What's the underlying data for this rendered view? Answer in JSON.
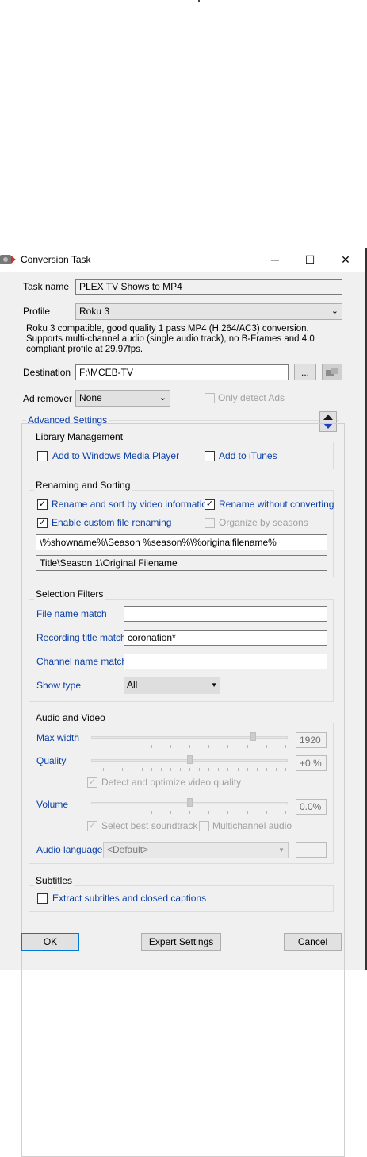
{
  "window": {
    "title": "Conversion Task",
    "minimize_glyph": "─",
    "maximize_glyph": "☐",
    "close_glyph": "✕"
  },
  "task": {
    "label": "Task name",
    "value": "PLEX TV Shows to MP4"
  },
  "profile": {
    "label": "Profile",
    "selected": "Roku 3",
    "description": "Roku 3 compatible, good quality 1 pass MP4 (H.264/AC3) conversion. Supports multi-channel audio (single audio track), no B-Frames and 4.0 compliant profile at 29.97fps."
  },
  "destination": {
    "label": "Destination",
    "value": "F:\\MCEB-TV",
    "browse_label": "..."
  },
  "ad_remover": {
    "label": "Ad remover",
    "selected": "None",
    "only_detect_label": "Only detect Ads"
  },
  "advanced": {
    "label": "Advanced Settings"
  },
  "library": {
    "title": "Library Management",
    "wmp_label": "Add to Windows Media Player",
    "itunes_label": "Add to iTunes"
  },
  "renaming": {
    "title": "Renaming and Sorting",
    "rename_sort_label": "Rename and sort by video information",
    "rename_without_label": "Rename without converting",
    "custom_label": "Enable custom file renaming",
    "seasons_label": "Organize by seasons",
    "pattern": "\\%showname%\\Season %season%\\%originalfilename%",
    "preview": "Title\\Season 1\\Original Filename",
    "check_glyph": "✓"
  },
  "filters": {
    "title": "Selection Filters",
    "file_name_label": "File name match",
    "file_name_value": "",
    "recording_label": "Recording title match",
    "recording_value": "coronation*",
    "channel_label": "Channel name match",
    "channel_value": "",
    "show_type_label": "Show type",
    "show_type_value": "All"
  },
  "av": {
    "title": "Audio and Video",
    "max_width_label": "Max width",
    "max_width_value": "1920",
    "max_width_level": 0.83,
    "quality_label": "Quality",
    "quality_value": "+0 %",
    "quality_level": 0.5,
    "detect_label": "Detect and optimize video quality",
    "volume_label": "Volume",
    "volume_value": "0.0%",
    "volume_level": 0.5,
    "best_soundtrack_label": "Select best soundtrack",
    "multichannel_label": "Multichannel audio",
    "audio_lang_label": "Audio language",
    "audio_lang_value": "<Default>"
  },
  "subtitles": {
    "title": "Subtitles",
    "extract_label": "Extract subtitles and closed captions"
  },
  "buttons": {
    "ok": "OK",
    "expert": "Expert Settings",
    "cancel": "Cancel"
  },
  "colors": {
    "link_blue": "#0b3fa8",
    "dialog_bg": "#f0f0f0",
    "default_button_border": "#0078d7"
  }
}
